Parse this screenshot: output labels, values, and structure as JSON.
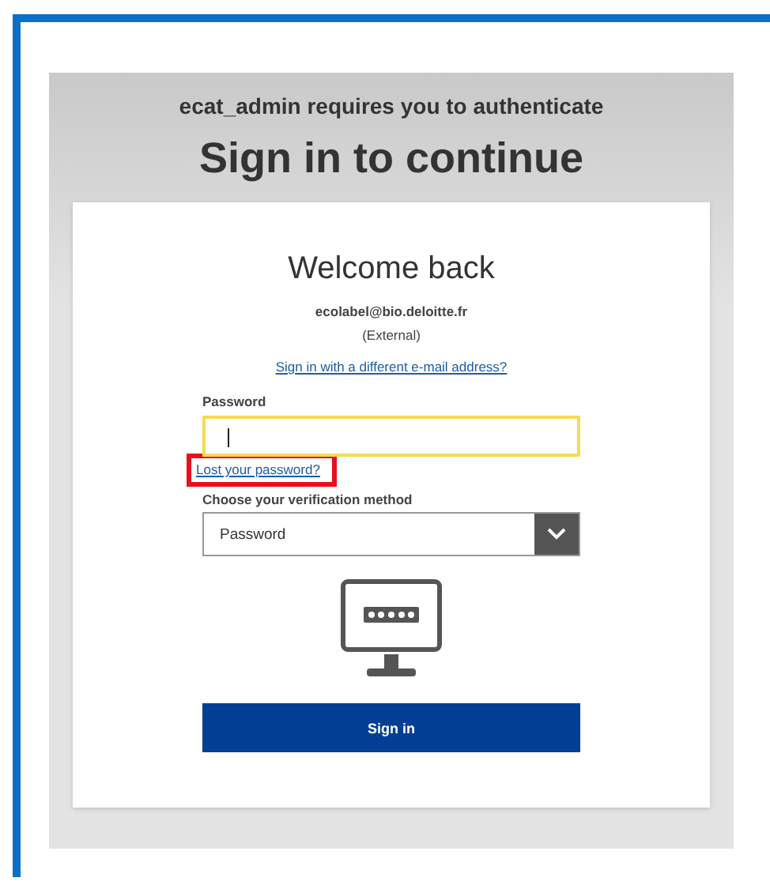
{
  "header": {
    "subtitle": "ecat_admin requires you to authenticate",
    "title": "Sign in to continue"
  },
  "card": {
    "heading": "Welcome back",
    "email": "ecolabel@bio.deloitte.fr",
    "account_type": "(External)",
    "switch_link": "Sign in with a different e-mail address?",
    "password": {
      "label": "Password",
      "focused": true
    },
    "lost_password_link": {
      "text": "Lost your password?",
      "highlighted": true
    },
    "verification": {
      "label": "Choose your verification method",
      "value": "Password"
    },
    "submit": "Sign in"
  }
}
